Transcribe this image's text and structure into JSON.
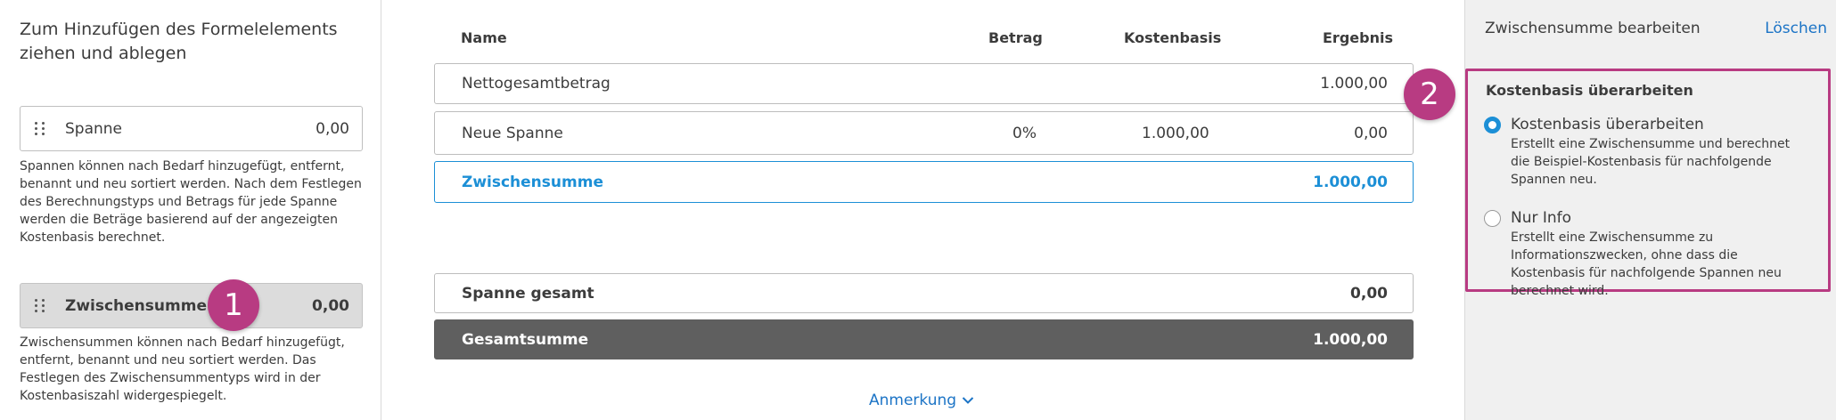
{
  "left_panel": {
    "title": "Zum Hinzufügen des Formelelements ziehen und ablegen",
    "items": [
      {
        "label": "Spanne",
        "value": "0,00",
        "description": "Spannen können nach Bedarf hinzugefügt, entfernt, benannt und neu sortiert werden. Nach dem Festlegen des Berechnungstyps und Betrags für jede Spanne werden die Beträge basierend auf der angezeigten Kostenbasis berechnet."
      },
      {
        "label": "Zwischensumme",
        "value": "0,00",
        "description": "Zwischensummen können nach Bedarf hinzugefügt, entfernt, benannt und neu sortiert werden. Das Festlegen des Zwischensummentyps wird in der Kostenbasiszahl widergespiegelt."
      }
    ]
  },
  "callouts": {
    "one": "1",
    "two": "2"
  },
  "table": {
    "headers": {
      "name": "Name",
      "amount": "Betrag",
      "cost_basis": "Kostenbasis",
      "result": "Ergebnis"
    },
    "rows": [
      {
        "name": "Nettogesamtbetrag",
        "amount": "",
        "cost_basis": "",
        "result": "1.000,00"
      },
      {
        "name": "Neue Spanne",
        "amount": "0%",
        "cost_basis": "1.000,00",
        "result": "0,00"
      },
      {
        "name": "Zwischensumme",
        "amount": "",
        "cost_basis": "",
        "result": "1.000,00"
      }
    ],
    "summary": [
      {
        "name": "Spanne gesamt",
        "result": "0,00"
      },
      {
        "name": "Gesamtsumme",
        "result": "1.000,00"
      }
    ],
    "note_link": "Anmerkung"
  },
  "right_panel": {
    "title": "Zwischensumme bearbeiten",
    "delete_label": "Löschen",
    "section_title": "Kostenbasis überarbeiten",
    "options": [
      {
        "label": "Kostenbasis überarbeiten",
        "description": "Erstellt eine Zwischensumme und berechnet die Beispiel-Kostenbasis für nachfolgende Spannen neu.",
        "checked": true
      },
      {
        "label": "Nur Info",
        "description": "Erstellt eine Zwischensumme zu Informationszwecken, ohne dass die Kostenbasis für nachfolgende Spannen neu berechnet wird.",
        "checked": false
      }
    ]
  },
  "colors": {
    "accent": "#1c8fd6",
    "link": "#1c74c6",
    "callout": "#b83b82",
    "total_bar": "#5f5f5f"
  },
  "icons": {
    "grip": "drag-handle-icon",
    "chevron": "chevron-down-icon"
  }
}
